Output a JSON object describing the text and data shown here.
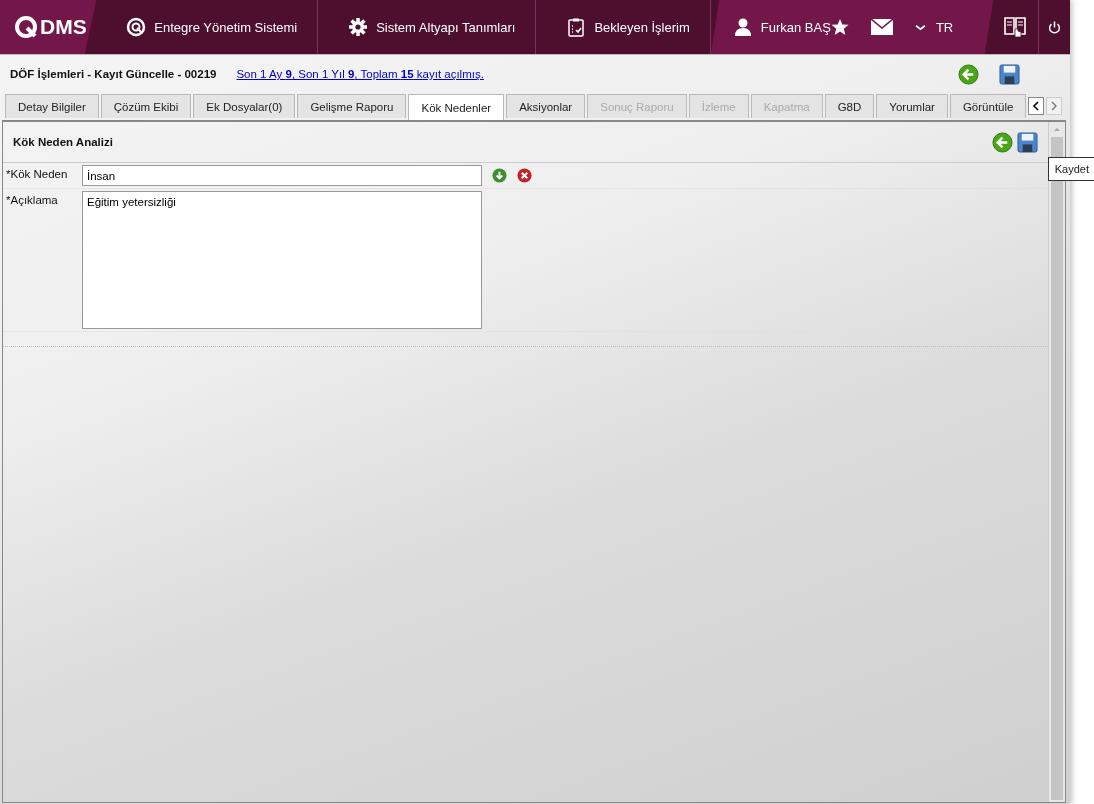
{
  "header": {
    "logo": "DMS",
    "nav": [
      {
        "label": "Entegre Yönetim Sistemi"
      },
      {
        "label": "Sistem Altyapı Tanımları"
      },
      {
        "label": "Bekleyen İşlerim"
      }
    ],
    "user": "Furkan BAŞ",
    "language": "TR"
  },
  "page": {
    "title": "DÖF İşlemleri - Kayıt Güncelle - 00219",
    "summary_link": "Son 1 Ay **9**, Son 1 Yıl **9**, Toplam **15** kayıt açılmış."
  },
  "tabs": [
    {
      "label": "Detay Bilgiler",
      "selected": false,
      "disabled": false
    },
    {
      "label": "Çözüm Ekibi",
      "selected": false,
      "disabled": false
    },
    {
      "label": "Ek Dosyalar(0)",
      "selected": false,
      "disabled": false
    },
    {
      "label": "Gelişme Raporu",
      "selected": false,
      "disabled": false
    },
    {
      "label": "Kök Nedenler",
      "selected": true,
      "disabled": false
    },
    {
      "label": "Aksiyonlar",
      "selected": false,
      "disabled": false
    },
    {
      "label": "Sonuç Raporu",
      "selected": false,
      "disabled": true
    },
    {
      "label": "İzleme",
      "selected": false,
      "disabled": true
    },
    {
      "label": "Kapatma",
      "selected": false,
      "disabled": true
    },
    {
      "label": "G8D",
      "selected": false,
      "disabled": false
    },
    {
      "label": "Yorumlar",
      "selected": false,
      "disabled": false
    },
    {
      "label": "Görüntüle",
      "selected": false,
      "disabled": false
    }
  ],
  "panel": {
    "title": "Kök Neden Analizi",
    "tooltip": "Kaydet",
    "fields": [
      {
        "label": "*Kök Neden",
        "value": "İnsan",
        "kind": "input"
      },
      {
        "label": "*Açıklama",
        "value": "Eğitim yetersizliği",
        "kind": "textarea"
      }
    ]
  }
}
